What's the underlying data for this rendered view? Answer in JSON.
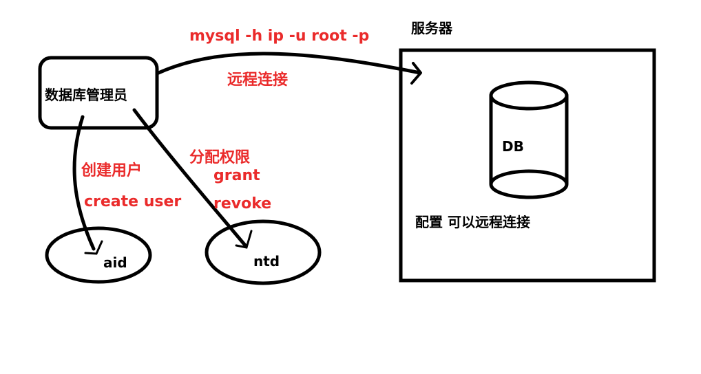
{
  "diagram": {
    "nodes": {
      "admin": {
        "label": "数据库管理员"
      },
      "server": {
        "title": "服务器",
        "note": "配置 可以远程连接"
      },
      "db": {
        "label": "DB"
      },
      "user_aid": {
        "label": "aid"
      },
      "user_ntd": {
        "label": "ntd"
      }
    },
    "edges": {
      "remote": {
        "command": "mysql -h ip -u root -p",
        "label": "远程连接"
      },
      "create": {
        "label": "创建用户",
        "command": "create user"
      },
      "grant": {
        "label": "分配权限",
        "command1": "grant",
        "command2": "revoke"
      }
    },
    "colors": {
      "annotation": "#ea2b2b",
      "stroke": "#000000"
    }
  }
}
